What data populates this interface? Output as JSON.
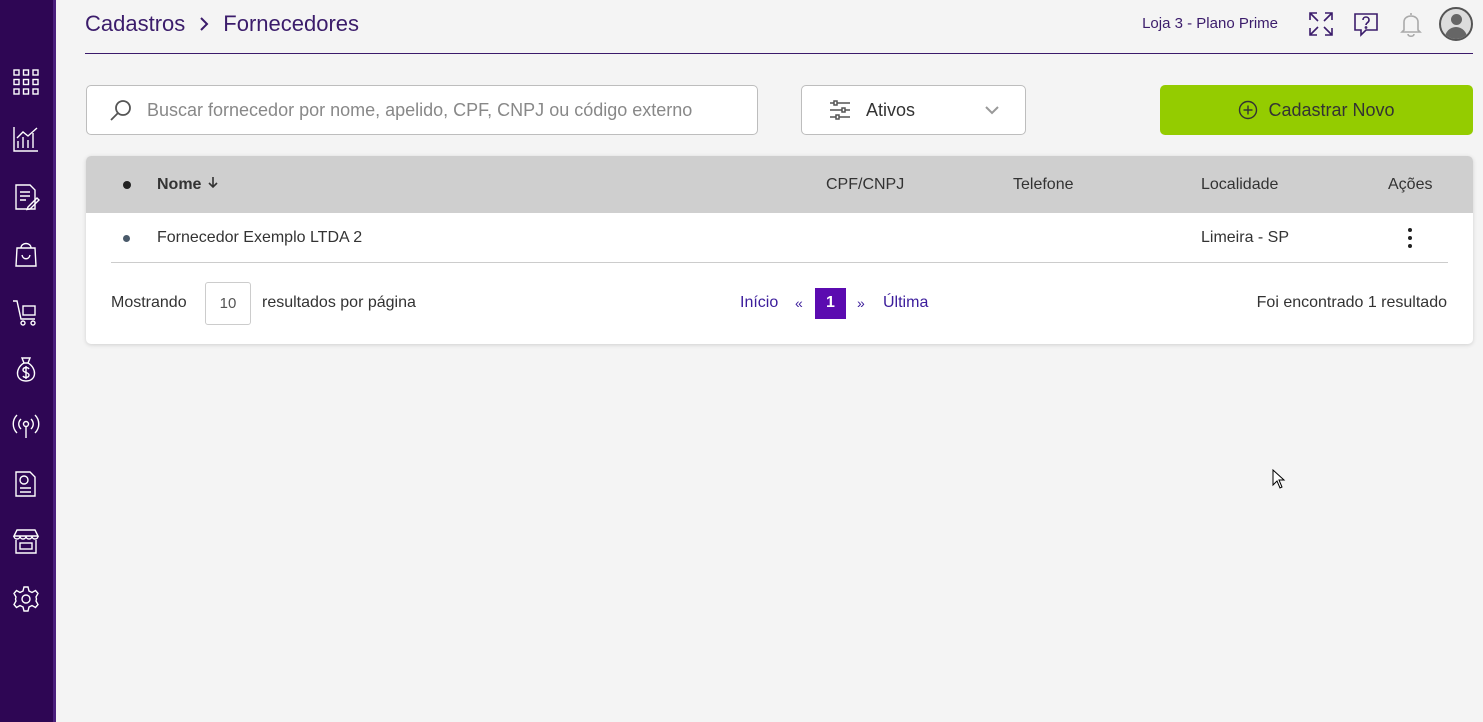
{
  "breadcrumb": {
    "parent": "Cadastros",
    "current": "Fornecedores"
  },
  "header": {
    "store": "Loja 3 - Plano Prime"
  },
  "search": {
    "placeholder": "Buscar fornecedor por nome, apelido, CPF, CNPJ ou código externo",
    "value": ""
  },
  "filter": {
    "selected": "Ativos"
  },
  "new_button": {
    "label": "Cadastrar Novo"
  },
  "table": {
    "columns": {
      "name": "Nome",
      "document": "CPF/CNPJ",
      "phone": "Telefone",
      "location": "Localidade",
      "actions": "Ações"
    },
    "rows": [
      {
        "name": "Fornecedor Exemplo LTDA 2",
        "document": "",
        "phone": "",
        "location": "Limeira - SP"
      }
    ]
  },
  "pagination": {
    "showing_label": "Mostrando",
    "per_page": "10",
    "per_page_suffix": "resultados por página",
    "first": "Início",
    "prev": "«",
    "current": "1",
    "next": "»",
    "last": "Última",
    "result_text": "Foi encontrado 1 resultado"
  },
  "colors": {
    "sidebar": "#2e0654",
    "accent": "#94cc00",
    "page_active": "#5b0bb0",
    "title": "#3b1c6b"
  },
  "sidebar_icons": [
    "apps-grid-icon",
    "chart-icon",
    "document-edit-icon",
    "shopping-bag-icon",
    "cart-icon",
    "money-bag-icon",
    "broadcast-icon",
    "receipt-icon",
    "store-icon",
    "settings-gear-icon"
  ]
}
